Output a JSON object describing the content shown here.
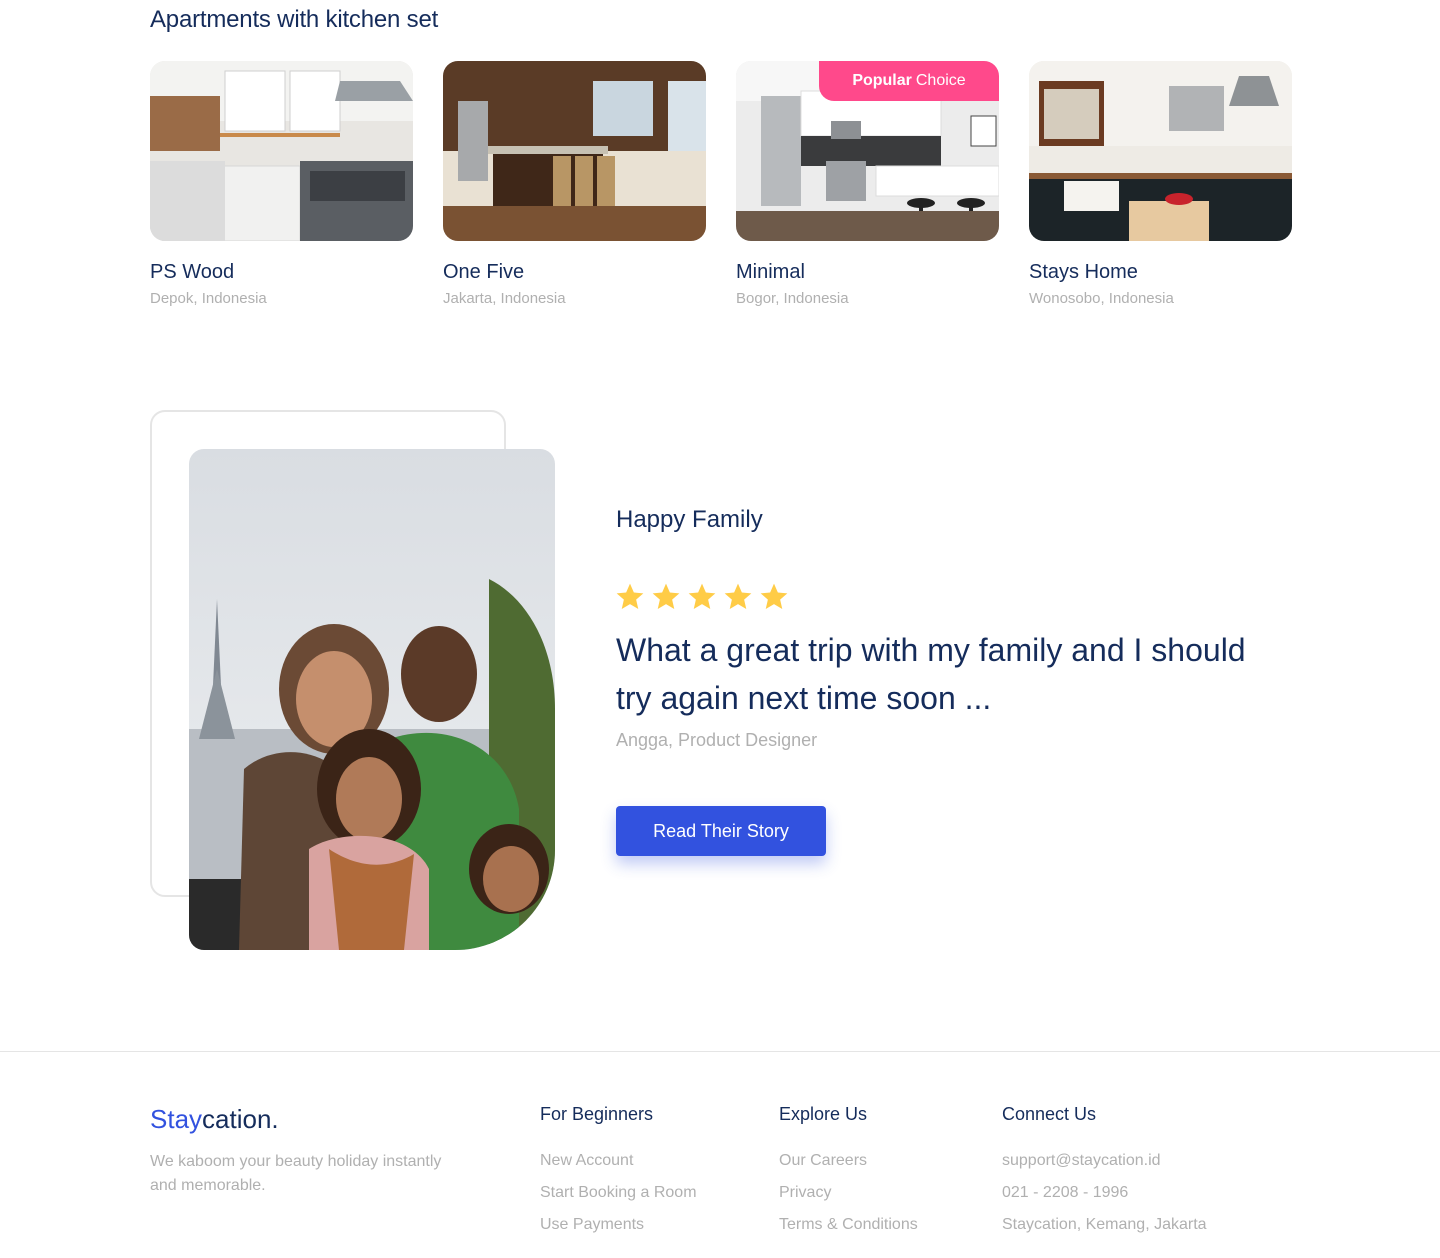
{
  "section": {
    "title": "Apartments with kitchen set"
  },
  "cards": [
    {
      "name": "PS Wood",
      "location": "Depok, Indonesia"
    },
    {
      "name": "One Five",
      "location": "Jakarta, Indonesia"
    },
    {
      "name": "Minimal",
      "location": "Bogor, Indonesia",
      "badge_strong": "Popular",
      "badge_light": "Choice"
    },
    {
      "name": "Stays Home",
      "location": "Wonosobo, Indonesia"
    }
  ],
  "testimonial": {
    "title": "Happy Family",
    "rating": 5,
    "quote": "What a great trip with my family and I should try again next time soon ...",
    "author": "Angga, Product Designer",
    "button_label": "Read Their Story"
  },
  "footer": {
    "brand_accent": "Stay",
    "brand_rest": "cation.",
    "tagline": "We kaboom your beauty holiday instantly and memorable.",
    "columns": [
      {
        "title": "For Beginners",
        "links": [
          "New Account",
          "Start Booking a Room",
          "Use Payments"
        ]
      },
      {
        "title": "Explore Us",
        "links": [
          "Our Careers",
          "Privacy",
          "Terms & Conditions"
        ]
      },
      {
        "title": "Connect Us",
        "links": [
          "support@staycation.id",
          "021 - 2208 - 1996",
          "Staycation, Kemang, Jakarta"
        ]
      }
    ]
  },
  "colors": {
    "primary": "#3252df",
    "text": "#152c5b",
    "muted": "#b0b0b0",
    "badge": "#ff498b",
    "star": "#ffcc47"
  }
}
